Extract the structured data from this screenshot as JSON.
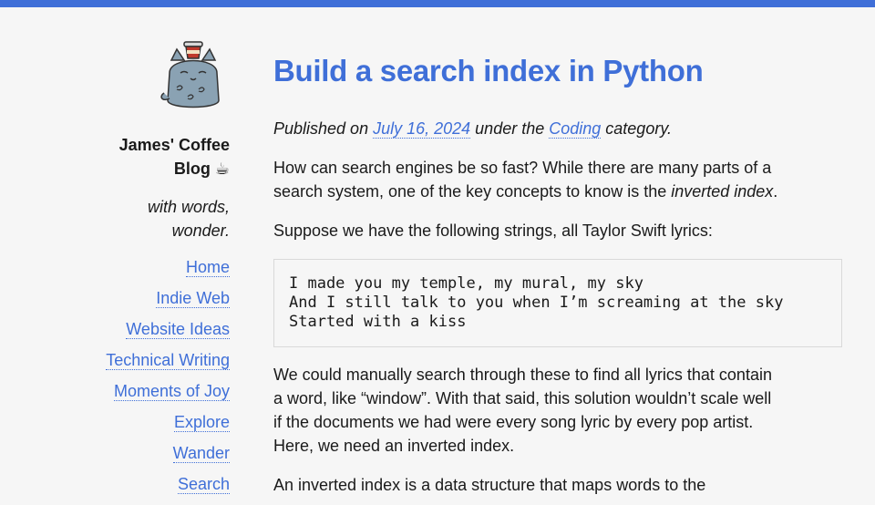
{
  "site": {
    "title": "James' Coffee Blog ☕",
    "tagline": "with words, wonder.",
    "avatar_icon": "cat-with-coffee-icon"
  },
  "nav": [
    {
      "label": "Home"
    },
    {
      "label": "Indie Web"
    },
    {
      "label": "Website Ideas"
    },
    {
      "label": "Technical Writing"
    },
    {
      "label": "Moments of Joy"
    },
    {
      "label": "Explore"
    },
    {
      "label": "Wander"
    },
    {
      "label": "Search"
    }
  ],
  "post": {
    "title": "Build a search index in Python",
    "meta_prefix": "Published on ",
    "date": "July 16, 2024",
    "meta_middle": " under the ",
    "category": "Coding",
    "meta_suffix": " category.",
    "p1_text": "How can search engines be so fast? While there are many parts of a search system, one of the key concepts to know is the ",
    "p1_em": "inverted index",
    "p1_end": ".",
    "p2": "Suppose we have the following strings, all Taylor Swift lyrics:",
    "code": "I made you my temple, my mural, my sky\nAnd I still talk to you when I’m screaming at the sky\nStarted with a kiss",
    "p3": "We could manually search through these to find all lyrics that contain a word, like “window”. With that said, this solution wouldn’t scale well if the documents we had were every song lyric by every pop artist. Here, we need an inverted index.",
    "p4": "An inverted index is a data structure that maps words to the"
  },
  "colors": {
    "accent": "#3f6fd8",
    "background": "#f6f6f6",
    "text": "#1a1a1a"
  }
}
